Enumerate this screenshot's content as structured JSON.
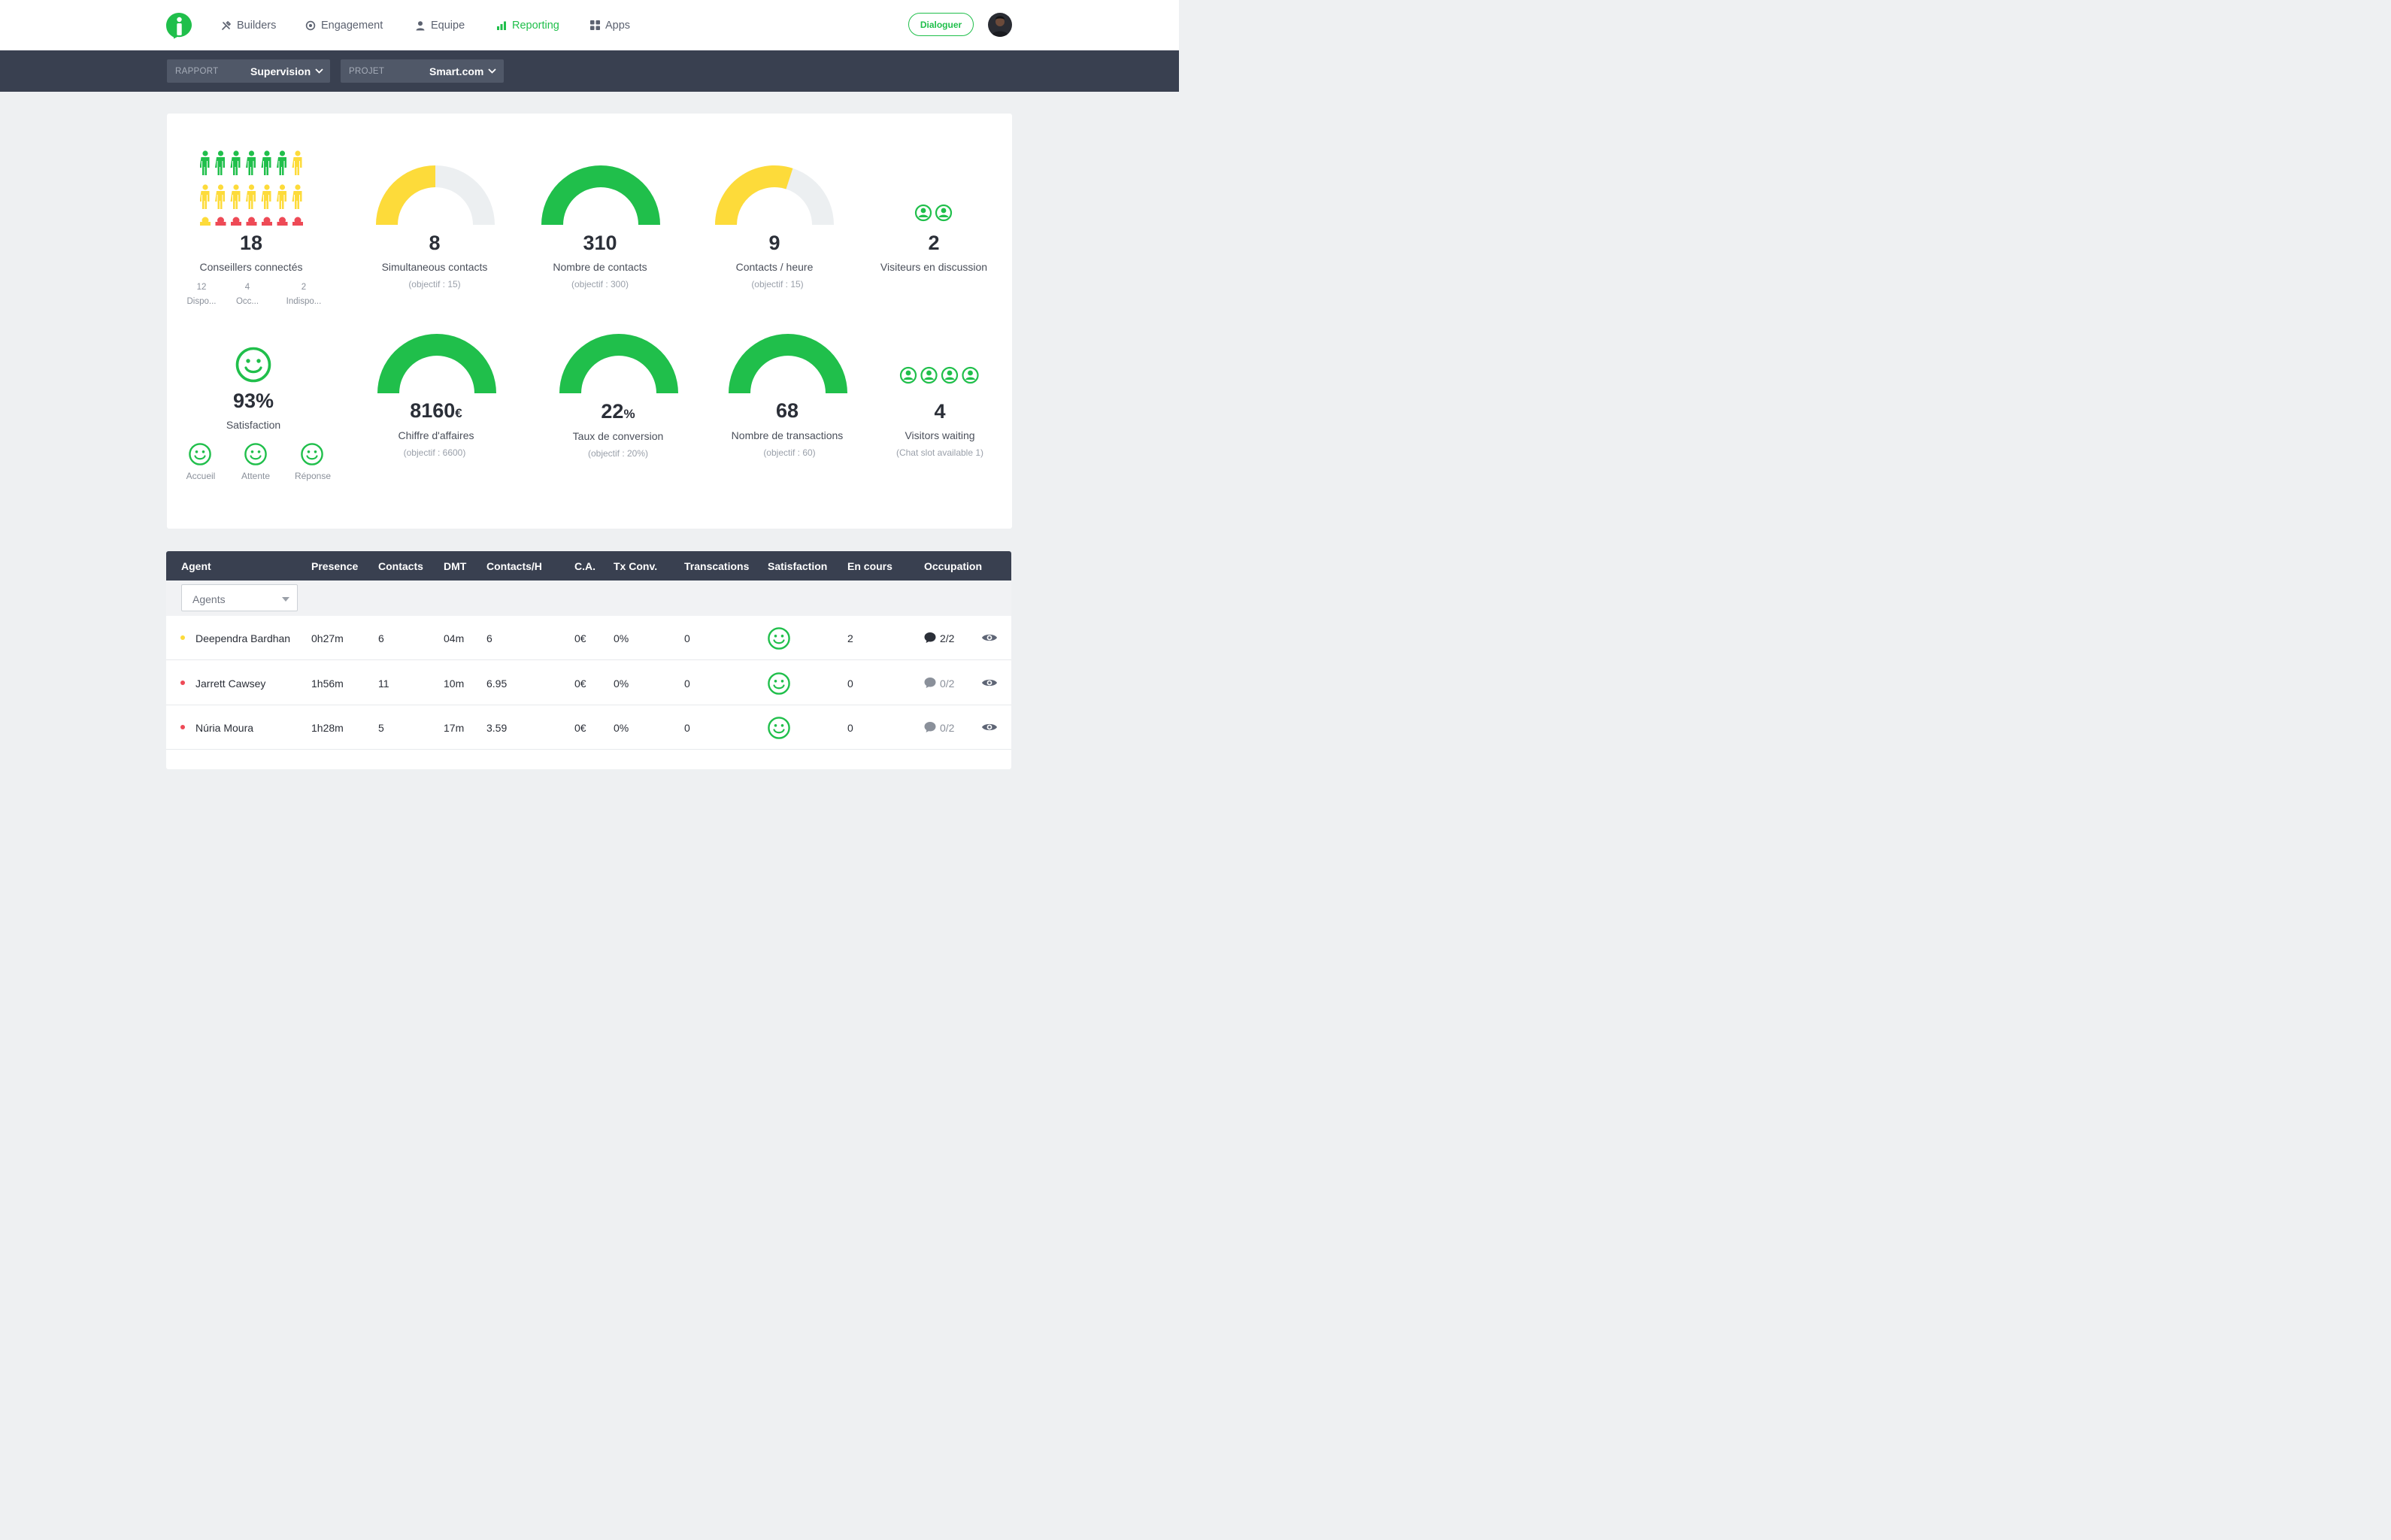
{
  "nav": {
    "items": [
      {
        "label": "Builders",
        "icon": "tools-icon"
      },
      {
        "label": "Engagement",
        "icon": "target-icon"
      },
      {
        "label": "Equipe",
        "icon": "user-icon"
      },
      {
        "label": "Reporting",
        "icon": "bar-chart-icon",
        "active": true
      },
      {
        "label": "Apps",
        "icon": "grid-icon"
      }
    ],
    "dialog_button": "Dialoguer"
  },
  "filters": {
    "rapport_label": "RAPPORT",
    "rapport_value": "Supervision",
    "projet_label": "PROJET",
    "projet_value": "Smart.com"
  },
  "colors": {
    "green": "#20bf4b",
    "yellow": "#fddb3a",
    "red": "#ee4a56",
    "gray": "#eceff1",
    "dark": "#394050"
  },
  "kpis": {
    "advisors": {
      "value": "18",
      "label": "Conseillers connectés",
      "breakdown": [
        {
          "count": "12",
          "label": "Dispo...",
          "color": "#20bf4b"
        },
        {
          "count": "4",
          "label": "Occ...",
          "color": "#fddb3a"
        },
        {
          "count": "2",
          "label": "Indispo...",
          "color": "#ee4a56"
        }
      ]
    },
    "simultaneous": {
      "value": "8",
      "label": "Simultaneous contacts",
      "objective": "(objectif : 15)",
      "fill": 0.5,
      "color": "#fddb3a"
    },
    "contacts": {
      "value": "310",
      "label": "Nombre de contacts",
      "objective": "(objectif : 300)",
      "fill": 1.0,
      "color": "#20bf4b"
    },
    "contacts_hour": {
      "value": "9",
      "label": "Contacts / heure",
      "objective": "(objectif : 15)",
      "fill": 0.6,
      "color": "#fddb3a"
    },
    "visitors_discussion": {
      "value": "2",
      "label": "Visiteurs en discussion"
    },
    "satisfaction": {
      "value": "93%",
      "label": "Satisfaction",
      "items": [
        {
          "label": "Accueil"
        },
        {
          "label": "Attente"
        },
        {
          "label": "Réponse"
        }
      ]
    },
    "revenue": {
      "value": "8160",
      "unit": "€",
      "label": "Chiffre d'affaires",
      "objective": "(objectif : 6600)",
      "fill": 1.0,
      "color": "#20bf4b"
    },
    "conversion": {
      "value": "22",
      "unit": "%",
      "label": "Taux de conversion",
      "objective": "(objectif : 20%)",
      "fill": 1.0,
      "color": "#20bf4b"
    },
    "transactions": {
      "value": "68",
      "label": "Nombre de transactions",
      "objective": "(objectif : 60)",
      "fill": 1.0,
      "color": "#20bf4b"
    },
    "visitors_waiting": {
      "value": "4",
      "label": "Visitors waiting",
      "objective": "(Chat slot available 1)"
    }
  },
  "table": {
    "columns": [
      "Agent",
      "Presence",
      "Contacts",
      "DMT",
      "Contacts/H",
      "C.A.",
      "Tx Conv.",
      "Transcations",
      "Satisfaction",
      "En cours",
      "Occupation"
    ],
    "filter_placeholder": "Agents",
    "rows": [
      {
        "status": "#fddb3a",
        "agent": "Deependra Bardhan",
        "presence": "0h27m",
        "contacts": "6",
        "dmt": "04m",
        "contacts_h": "6",
        "ca": "0€",
        "tx": "0%",
        "transactions": "0",
        "en_cours": "2",
        "occupation": "2/2",
        "occupied": true
      },
      {
        "status": "#ee4a56",
        "agent": "Jarrett Cawsey",
        "presence": "1h56m",
        "contacts": "11",
        "dmt": "10m",
        "contacts_h": "6.95",
        "ca": "0€",
        "tx": "0%",
        "transactions": "0",
        "en_cours": "0",
        "occupation": "0/2",
        "occupied": false
      },
      {
        "status": "#ee4a56",
        "agent": "Núria Moura",
        "presence": "1h28m",
        "contacts": "5",
        "dmt": "17m",
        "contacts_h": "3.59",
        "ca": "0€",
        "tx": "0%",
        "transactions": "0",
        "en_cours": "0",
        "occupation": "0/2",
        "occupied": false
      }
    ]
  }
}
